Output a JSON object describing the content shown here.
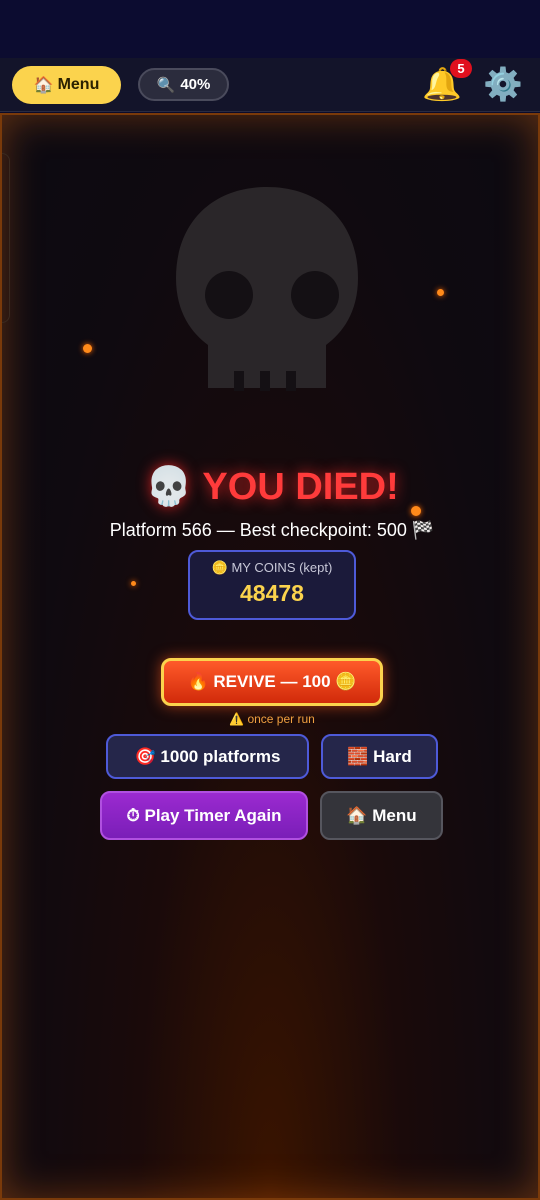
{
  "topbar": {
    "menu_icon": "🏠",
    "menu_label": "Menu",
    "zoom_icon": "🔍",
    "zoom_label": "40%",
    "bell_icon": "🔔",
    "notification_count": "5",
    "settings_icon": "⚙️"
  },
  "game": {
    "title_icon": "💀",
    "title": "YOU DIED!",
    "subtitle": "Platform 566 — Best checkpoint: 500 🏁",
    "coins_label": "🪙 MY COINS (kept)",
    "coins_value": "48478",
    "revive_label": "🔥 REVIVE — 100 🪙",
    "once_note": "⚠️ once per run",
    "buttons": {
      "platforms": "🎯 1000 platforms",
      "difficulty": "🧱 Hard",
      "play_again": "⏱ Play Timer Again",
      "menu": "🏠 Menu"
    }
  },
  "colors": {
    "accent_yellow": "#fbd34d",
    "danger_red": "#ff3b3b",
    "ember_orange": "#ff8a1a",
    "button_blue_border": "#4e5ad8",
    "purple": "#9b2ad0"
  }
}
